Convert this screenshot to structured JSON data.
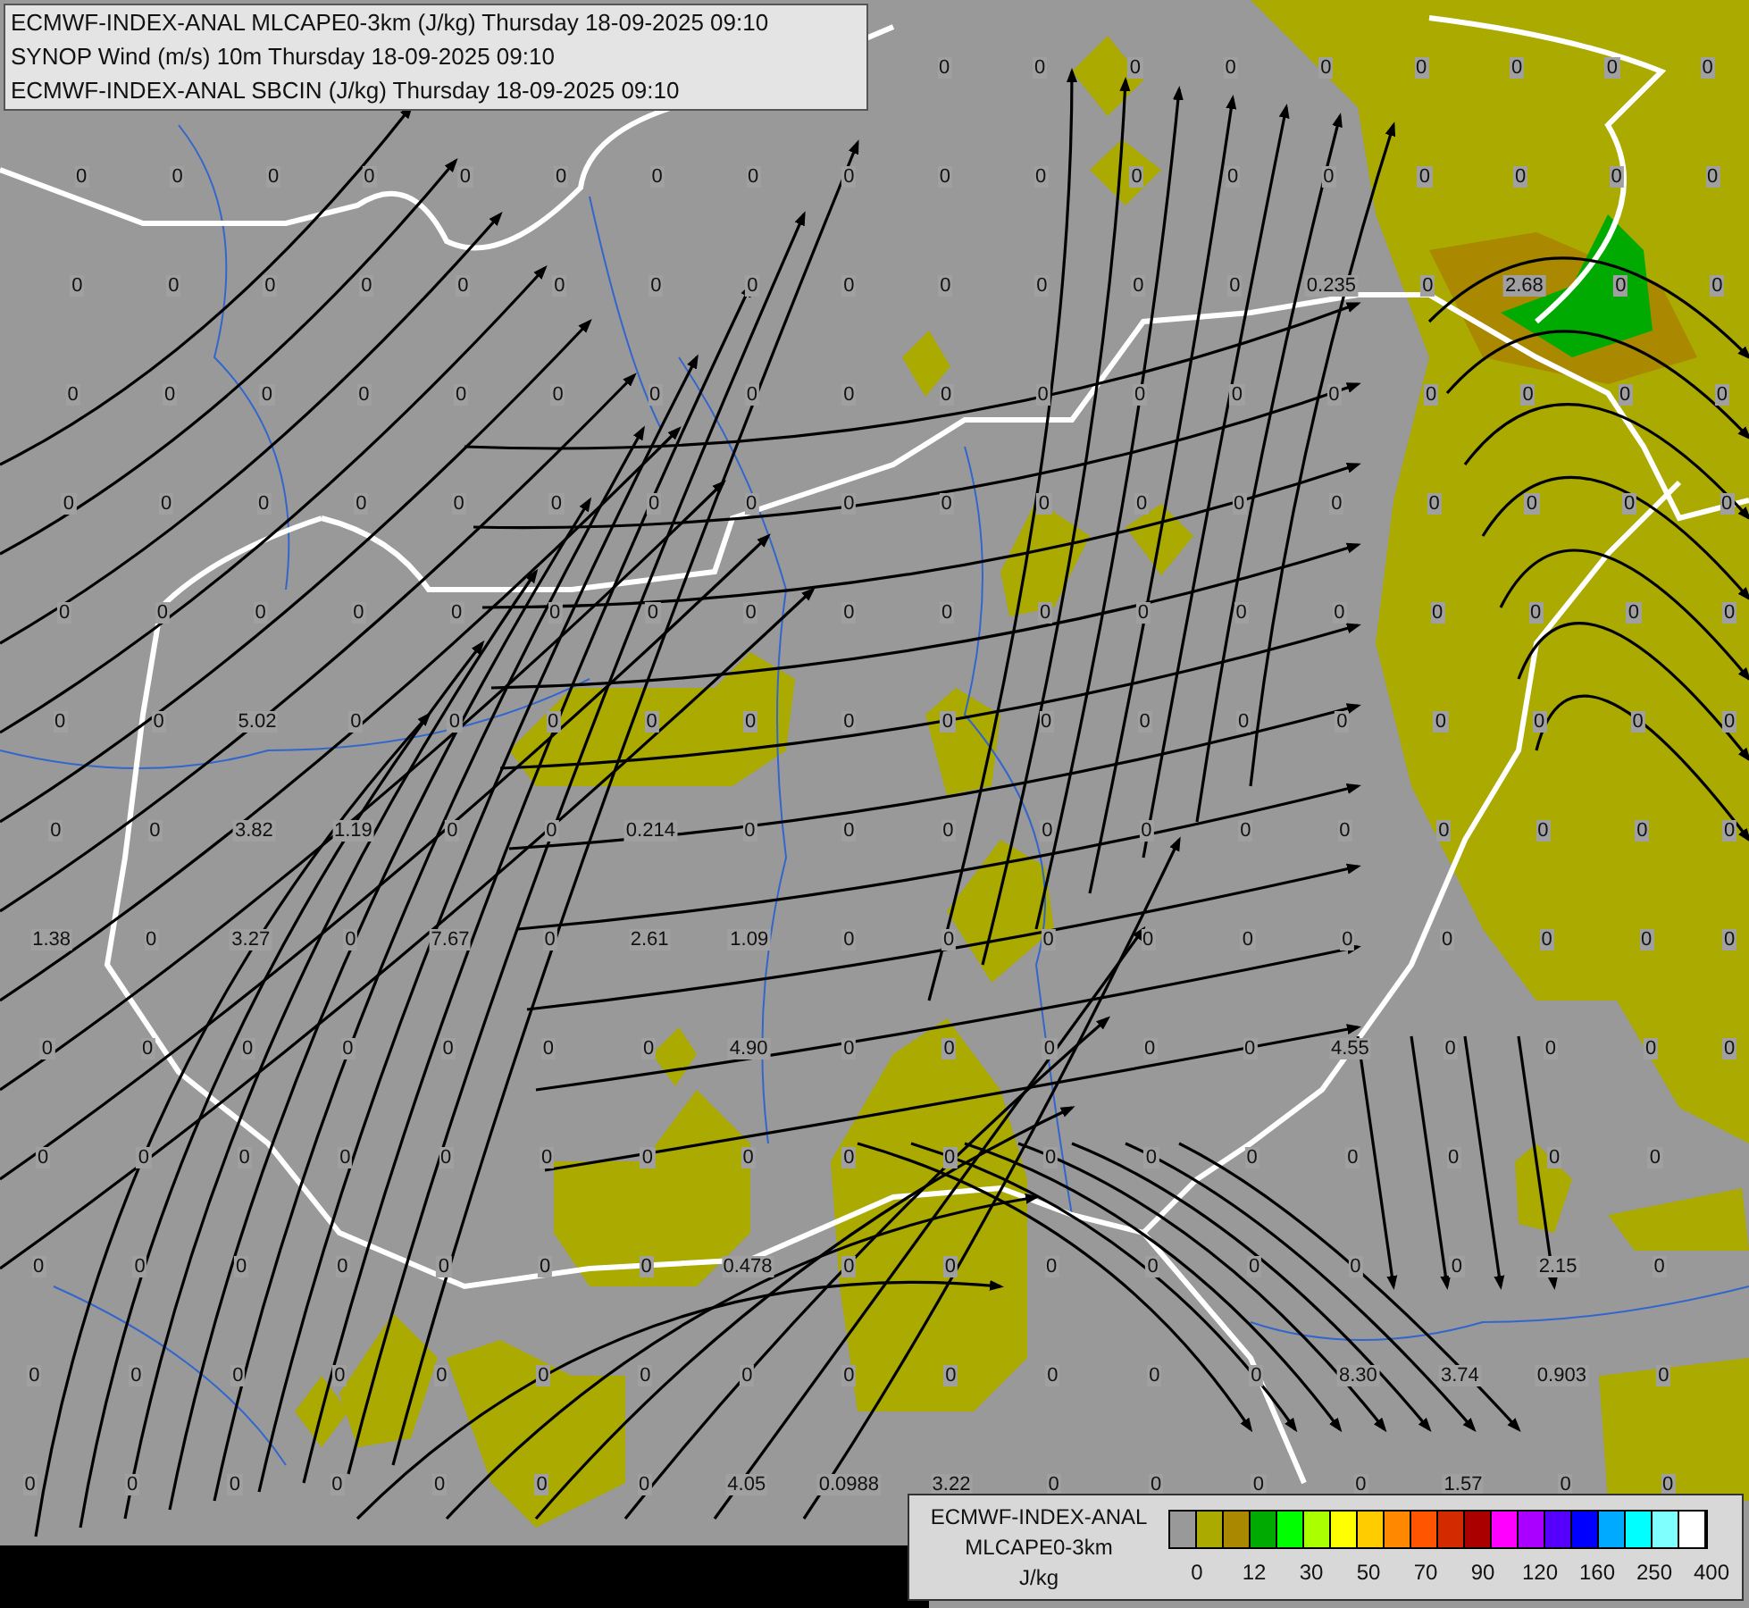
{
  "title_box": {
    "lines": [
      "ECMWF-INDEX-ANAL MLCAPE0-3km (J/kg) Thursday 18-09-2025 09:10",
      "SYNOP Wind (m/s) 10m Thursday 18-09-2025 09:10",
      "ECMWF-INDEX-ANAL SBCIN (J/kg) Thursday 18-09-2025 09:10"
    ]
  },
  "station_values": [
    {
      "kind": "tail",
      "values": [
        "0",
        "0",
        "0",
        "0",
        "0",
        "0",
        "0",
        "0",
        "0"
      ]
    },
    [
      "0",
      "0",
      "0",
      "0",
      "0",
      "0",
      "0",
      "0",
      "0",
      "0",
      "0",
      "0",
      "0",
      "0",
      "0",
      "0",
      "0",
      "0"
    ],
    [
      "0",
      "0",
      "0",
      "0",
      "0",
      "0",
      "0",
      "0",
      "0",
      "0",
      "0",
      "0",
      "0",
      "0.235",
      "0",
      "2.68",
      "0",
      "0"
    ],
    [
      "0",
      "0",
      "0",
      "0",
      "0",
      "0",
      "0",
      "0",
      "0",
      "0",
      "0",
      "0",
      "0",
      "0",
      "0",
      "0",
      "0",
      "0"
    ],
    [
      "0",
      "0",
      "0",
      "0",
      "0",
      "0",
      "0",
      "0",
      "0",
      "0",
      "0",
      "0",
      "0",
      "0",
      "0",
      "0",
      "0",
      "0"
    ],
    [
      "0",
      "0",
      "0",
      "0",
      "0",
      "0",
      "0",
      "0",
      "0",
      "0",
      "0",
      "0",
      "0",
      "0",
      "0",
      "0",
      "0",
      "0"
    ],
    [
      "0",
      "0",
      "5.02",
      "0",
      "0",
      "0",
      "0",
      "0",
      "0",
      "0",
      "0",
      "0",
      "0",
      "0",
      "0",
      "0",
      "0",
      "0"
    ],
    [
      "0",
      "0",
      "3.82",
      "1.19",
      "0",
      "0",
      "0.214",
      "0",
      "0",
      "0",
      "0",
      "0",
      "0",
      "0",
      "0",
      "0",
      "0",
      "0"
    ],
    [
      "1.38",
      "0",
      "3.27",
      "0",
      "7.67",
      "0",
      "2.61",
      "1.09",
      "0",
      "0",
      "0",
      "0",
      "0",
      "0",
      "0",
      "0",
      "0",
      "0"
    ],
    [
      "0",
      "0",
      "0",
      "0",
      "0",
      "0",
      "0",
      "4.90",
      "0",
      "0",
      "0",
      "0",
      "0",
      "4.55",
      "0",
      "0",
      "0",
      "0"
    ],
    [
      "0",
      "0",
      "0",
      "0",
      "0",
      "0",
      "0",
      "0",
      "0",
      "0",
      "0",
      "0",
      "0",
      "0",
      "0",
      "0",
      "0"
    ],
    [
      "0",
      "0",
      "0",
      "0",
      "0",
      "0",
      "0",
      "0.478",
      "0",
      "0",
      "0",
      "0",
      "0",
      "0",
      "0",
      "2.15",
      "0"
    ],
    [
      "0",
      "0",
      "0",
      "0",
      "0",
      "0",
      "0",
      "0",
      "0",
      "0",
      "0",
      "0",
      "0",
      "8.30",
      "3.74",
      "0.903",
      "0"
    ],
    [
      "0",
      "0",
      "0",
      "0",
      "0",
      "0",
      "0",
      "4.05",
      "0.0988",
      "3.22",
      "0",
      "0",
      "0",
      "0",
      "1.57",
      "0",
      "0"
    ]
  ],
  "legend": {
    "lines": [
      "ECMWF-INDEX-ANAL",
      "MLCAPE0-3km",
      "J/kg"
    ],
    "swatches": [
      {
        "color": "#999999"
      },
      {
        "color": "#aaaa00"
      },
      {
        "color": "#aa8800"
      },
      {
        "color": "#00aa00"
      },
      {
        "color": "#00ff00"
      },
      {
        "color": "#aaff00"
      },
      {
        "color": "#ffff00"
      },
      {
        "color": "#ffcc00"
      },
      {
        "color": "#ff8800"
      },
      {
        "color": "#ff5500"
      },
      {
        "color": "#d42a00"
      },
      {
        "color": "#aa0000"
      },
      {
        "color": "#ff00ff"
      },
      {
        "color": "#aa00ff"
      },
      {
        "color": "#5500ff"
      },
      {
        "color": "#0000ff"
      },
      {
        "color": "#00aaff"
      },
      {
        "color": "#00ffff"
      },
      {
        "color": "#80ffff"
      },
      {
        "color": "#ffffff"
      }
    ],
    "ticks": [
      "0",
      "12",
      "30",
      "50",
      "70",
      "90",
      "120",
      "160",
      "250",
      "400"
    ]
  }
}
